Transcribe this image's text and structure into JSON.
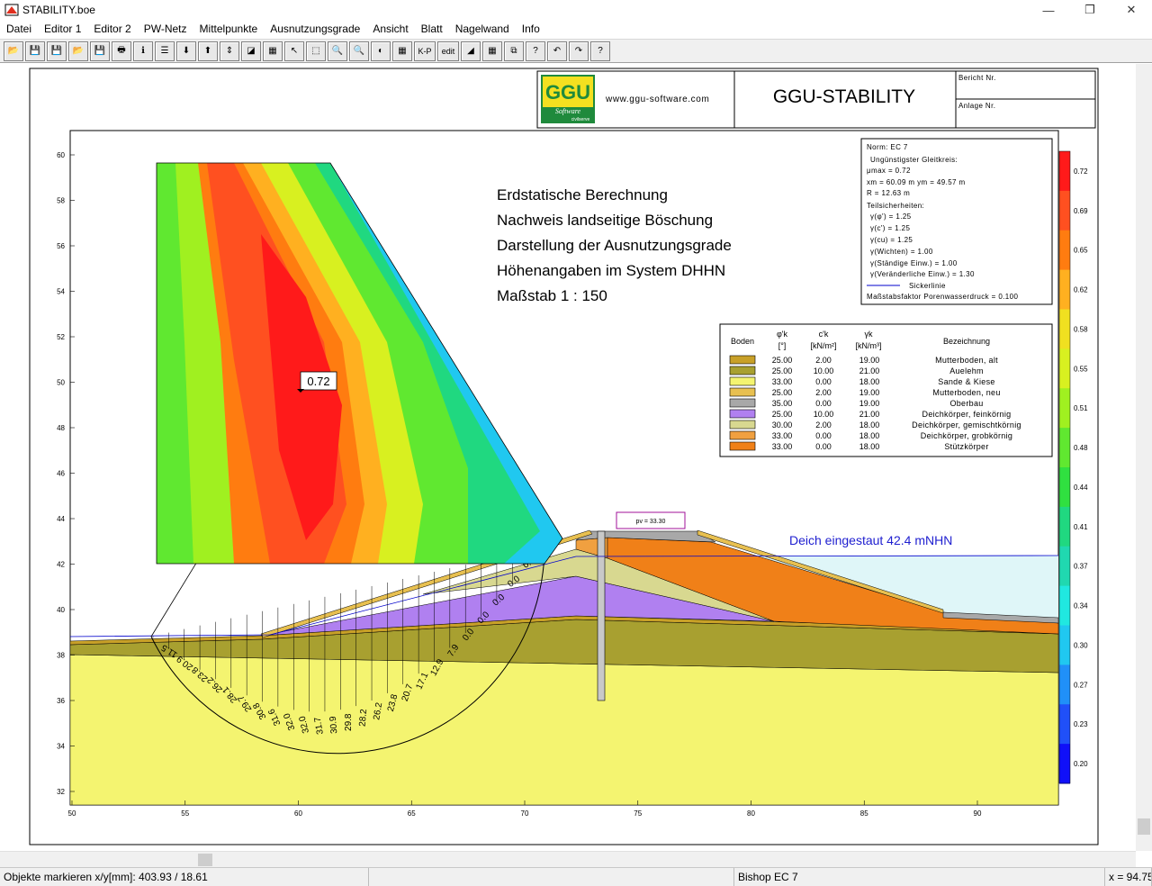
{
  "window": {
    "title": "STABILITY.boe",
    "minimize": "—",
    "restore": "❐",
    "close": "✕"
  },
  "menu": [
    "Datei",
    "Editor 1",
    "Editor 2",
    "PW-Netz",
    "Mittelpunkte",
    "Ausnutzungsgrade",
    "Ansicht",
    "Blatt",
    "Nagelwand",
    "Info"
  ],
  "toolbar": [
    {
      "name": "open-file",
      "glyph": "📂"
    },
    {
      "name": "save",
      "glyph": "💾"
    },
    {
      "name": "save-as",
      "glyph": "💾"
    },
    {
      "name": "open-folder",
      "glyph": "📂"
    },
    {
      "name": "save-copy",
      "glyph": "💾"
    },
    {
      "name": "print",
      "glyph": "🖶"
    },
    {
      "name": "info",
      "glyph": "ℹ"
    },
    {
      "name": "list",
      "glyph": "☰"
    },
    {
      "name": "move-down",
      "glyph": "⬇"
    },
    {
      "name": "move-up",
      "glyph": "⬆"
    },
    {
      "name": "move-vertical",
      "glyph": "⇕"
    },
    {
      "name": "view-3d",
      "glyph": "◪"
    },
    {
      "name": "color-mode",
      "glyph": "▦"
    },
    {
      "name": "select-pointer",
      "glyph": "↖"
    },
    {
      "name": "select-area",
      "glyph": "⬚"
    },
    {
      "name": "zoom-out",
      "glyph": "🔍"
    },
    {
      "name": "zoom-in",
      "glyph": "🔍"
    },
    {
      "name": "fill",
      "glyph": "◐"
    },
    {
      "name": "grid",
      "glyph": "▦"
    },
    {
      "name": "kp",
      "glyph": "K-P"
    },
    {
      "name": "edit",
      "glyph": "edit"
    },
    {
      "name": "layer",
      "glyph": "◢"
    },
    {
      "name": "table",
      "glyph": "▦"
    },
    {
      "name": "copy",
      "glyph": "⧉"
    },
    {
      "name": "help-context",
      "glyph": "?"
    },
    {
      "name": "undo",
      "glyph": "↶"
    },
    {
      "name": "redo",
      "glyph": "↷"
    },
    {
      "name": "help",
      "glyph": "?"
    }
  ],
  "header": {
    "url": "www.ggu-software.com",
    "title": "GGU-STABILITY",
    "bericht": "Bericht Nr.",
    "anlage": "Anlage Nr.",
    "logo_text": "GGU",
    "logo_sub": "Software",
    "logo_civil": "civilserve"
  },
  "heading_lines": [
    "Erdstatische Berechnung",
    "Nachweis landseitige Böschung",
    "Darstellung der Ausnutzungsgrade",
    "Höhenangaben im System DHHN",
    "Maßstab 1 : 150"
  ],
  "info_box": {
    "norm": "Norm: EC 7",
    "gleitkreis": "Ungünstigster Gleitkreis:",
    "mu": "μmax = 0.72",
    "xm": "xm = 60.09 m   ym = 49.57 m",
    "r": "R = 12.63 m",
    "teil": "Teilsicherheiten:",
    "g1": "γ(φ') = 1.25",
    "g2": "γ(c') = 1.25",
    "g3": "γ(cu) = 1.25",
    "g4": "γ(Wichten) = 1.00",
    "g5": "γ(Ständige Einw.) = 1.00",
    "g6": "γ(Veränderliche Einw.) = 1.30",
    "sicker": "Sickerlinie",
    "mass": "Maßstabsfaktor Porenwasserdruck = 0.100"
  },
  "soil_table": {
    "headers": [
      "Boden",
      "φ'k",
      "c'k",
      "γk",
      "Bezeichnung"
    ],
    "units": [
      "",
      "[°]",
      "[kN/m²]",
      "[kN/m³]",
      ""
    ],
    "rows": [
      {
        "color": "#c8a028",
        "phi": "25.00",
        "c": "2.00",
        "gamma": "19.00",
        "name": "Mutterboden, alt"
      },
      {
        "color": "#a8a030",
        "phi": "25.00",
        "c": "10.00",
        "gamma": "21.00",
        "name": "Auelehm"
      },
      {
        "color": "#f4f470",
        "phi": "33.00",
        "c": "0.00",
        "gamma": "18.00",
        "name": "Sande & Kiese"
      },
      {
        "color": "#e8c050",
        "phi": "25.00",
        "c": "2.00",
        "gamma": "19.00",
        "name": "Mutterboden, neu"
      },
      {
        "color": "#a8a8a8",
        "phi": "35.00",
        "c": "0.00",
        "gamma": "19.00",
        "name": "Oberbau"
      },
      {
        "color": "#b080f0",
        "phi": "25.00",
        "c": "10.00",
        "gamma": "21.00",
        "name": "Deichkörper, feinkörnig"
      },
      {
        "color": "#d8d890",
        "phi": "30.00",
        "c": "2.00",
        "gamma": "18.00",
        "name": "Deichkörper, gemischtkörnig"
      },
      {
        "color": "#f0a040",
        "phi": "33.00",
        "c": "0.00",
        "gamma": "18.00",
        "name": "Deichkörper, grobkörnig"
      },
      {
        "color": "#f08018",
        "phi": "33.00",
        "c": "0.00",
        "gamma": "18.00",
        "name": "Stützkörper"
      }
    ]
  },
  "water_label": "Deich eingestaut 42.4 mNHN",
  "load_label": "pv = 33.30",
  "max_label": "0.72",
  "colorbar": {
    "labels": [
      "0.72",
      "0.69",
      "0.65",
      "0.62",
      "0.58",
      "0.55",
      "0.51",
      "0.48",
      "0.44",
      "0.41",
      "0.37",
      "0.34",
      "0.30",
      "0.27",
      "0.23",
      "0.20"
    ],
    "colors": [
      "#ff1a1a",
      "#ff5020",
      "#ff7c10",
      "#ffb020",
      "#f0e020",
      "#d8f020",
      "#a0f020",
      "#60e830",
      "#30e040",
      "#20d880",
      "#20d8b0",
      "#20e8e0",
      "#20c8f0",
      "#2090f8",
      "#2050f8",
      "#1010f8"
    ]
  },
  "axes": {
    "x_ticks": [
      "50",
      "55",
      "60",
      "65",
      "70",
      "75",
      "80",
      "85",
      "90"
    ],
    "y_ticks": [
      "32",
      "34",
      "36",
      "38",
      "40",
      "42",
      "44",
      "46",
      "48",
      "50",
      "52",
      "54",
      "56",
      "58",
      "60"
    ]
  },
  "slice_labels": [
    "11.5",
    "20.9",
    "23.8",
    "26.2",
    "28.1",
    "29.7",
    "30.8",
    "31.6",
    "32.0",
    "32.0",
    "31.7",
    "30.9",
    "29.8",
    "28.2",
    "26.2",
    "23.8",
    "20.7",
    "17.1",
    "12.9",
    "7.9",
    "0.0",
    "0.0",
    "0.0",
    "0.0",
    "0.0"
  ],
  "status": {
    "mode": "Objekte markieren  x/y[mm]: 403.93 / 18.61",
    "method": "Bishop  EC 7",
    "x": "x = 94.75"
  }
}
